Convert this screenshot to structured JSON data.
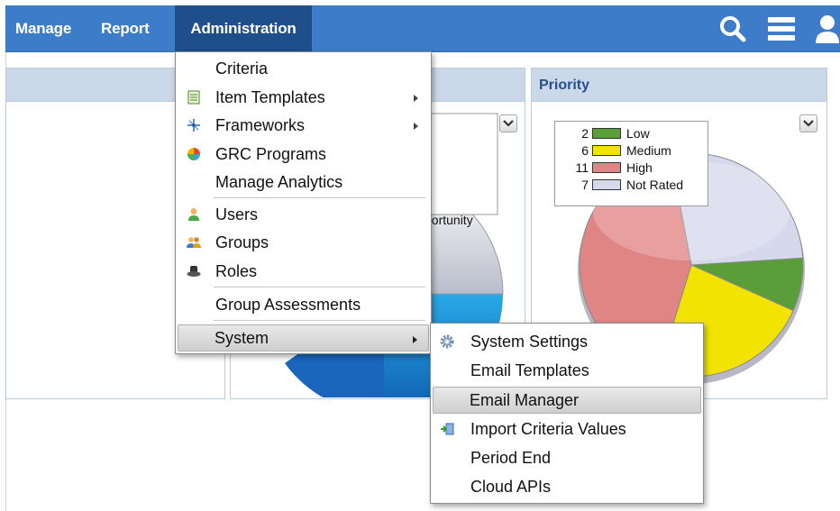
{
  "nav": {
    "items": [
      {
        "label": "Manage"
      },
      {
        "label": "Report"
      },
      {
        "label": "Administration",
        "active": true
      }
    ],
    "icons": [
      "search-icon",
      "menu-icon",
      "user-icon"
    ]
  },
  "panels": {
    "left": {
      "title": ""
    },
    "middle": {
      "title": "",
      "legend_partial_text": "portunity"
    },
    "priority": {
      "title": "Priority",
      "chart_data": {
        "type": "pie",
        "title": "Priority",
        "legend_position": "top-left",
        "slices": [
          {
            "name": "Low",
            "value": 2,
            "color": "#5a9e3a"
          },
          {
            "name": "Medium",
            "value": 6,
            "color": "#f2e400"
          },
          {
            "name": "High",
            "value": 11,
            "color": "#e08585"
          },
          {
            "name": "Not Rated",
            "value": 7,
            "color": "#d6d9ec"
          }
        ]
      }
    }
  },
  "admin_menu": {
    "items": [
      {
        "label": "Criteria",
        "icon": "",
        "submenu": false
      },
      {
        "label": "Item Templates",
        "icon": "template-icon",
        "submenu": true
      },
      {
        "label": "Frameworks",
        "icon": "frameworks-icon",
        "submenu": true
      },
      {
        "label": "GRC Programs",
        "icon": "grc-programs-icon",
        "submenu": false
      },
      {
        "label": "Manage Analytics",
        "icon": "",
        "submenu": false
      },
      {
        "label": "Users",
        "icon": "user-icon",
        "submenu": false
      },
      {
        "label": "Groups",
        "icon": "groups-icon",
        "submenu": false
      },
      {
        "label": "Roles",
        "icon": "roles-icon",
        "submenu": false
      },
      {
        "label": "Group Assessments",
        "icon": "",
        "submenu": false
      },
      {
        "label": "System",
        "icon": "",
        "submenu": true,
        "highlighted": true
      }
    ]
  },
  "system_menu": {
    "items": [
      {
        "label": "System Settings",
        "icon": "gear-icon"
      },
      {
        "label": "Email Templates",
        "icon": ""
      },
      {
        "label": "Email Manager",
        "icon": "",
        "highlighted": true
      },
      {
        "label": "Import Criteria Values",
        "icon": "import-icon"
      },
      {
        "label": "Period End",
        "icon": ""
      },
      {
        "label": "Cloud APIs",
        "icon": ""
      }
    ]
  },
  "colors": {
    "nav_bg": "#3d7cc8",
    "nav_active": "#1f4f8a",
    "panel_header": "#cad8e9",
    "panel_title": "#2a4f8f"
  }
}
